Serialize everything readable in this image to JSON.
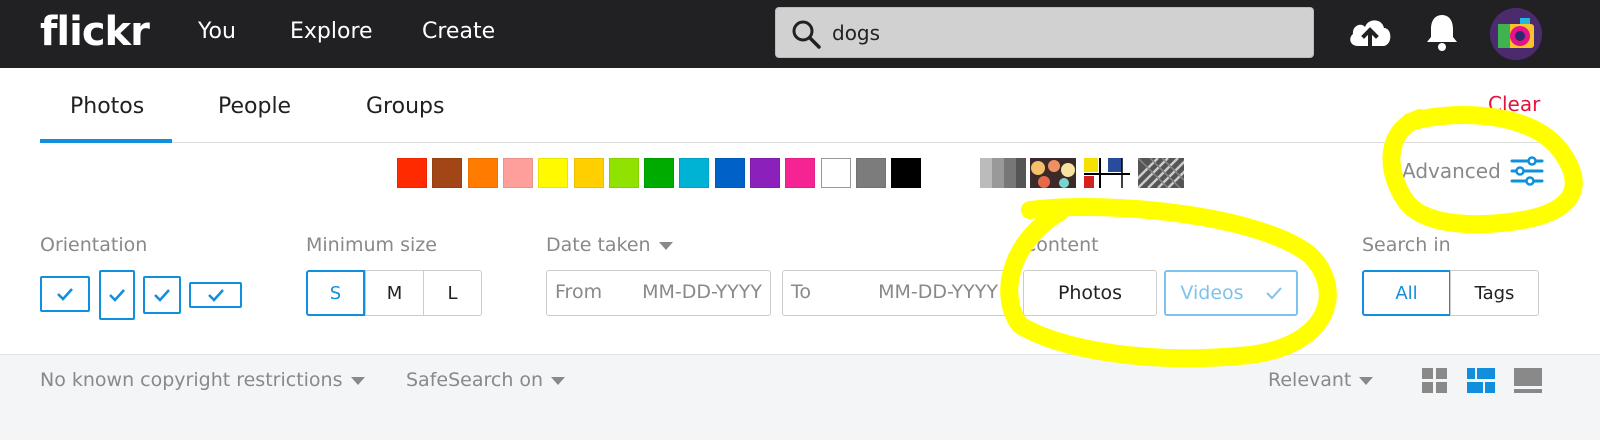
{
  "header": {
    "logo": "flickr",
    "nav": [
      "You",
      "Explore",
      "Create"
    ],
    "search": {
      "value": "dogs",
      "icon": "search-icon"
    },
    "icons": [
      "upload-cloud-icon",
      "bell-icon",
      "avatar"
    ]
  },
  "tabs": {
    "items": [
      "Photos",
      "People",
      "Groups"
    ],
    "active": "Photos",
    "clear_label": "Clear"
  },
  "colors": {
    "swatches": [
      "#ff2a00",
      "#a24615",
      "#ff7c00",
      "#ff9f9c",
      "#fffa00",
      "#ffcf00",
      "#90e200",
      "#00ab00",
      "#00b2d4",
      "#0062c6",
      "#8c20ba",
      "#f52394",
      "#ffffff",
      "#7c7c7c",
      "#000000"
    ],
    "style_swatches": [
      "black-and-white",
      "shallow-depth-of-field",
      "minimalist",
      "patterns"
    ],
    "accent": "#128fdc",
    "clear_color": "#e6123d",
    "annotation_color": "#ffff00"
  },
  "advanced": {
    "label": "Advanced",
    "icon": "sliders-icon"
  },
  "filters": {
    "orientation": {
      "label": "Orientation"
    },
    "min_size": {
      "label": "Minimum size",
      "options": [
        "S",
        "M",
        "L"
      ],
      "selected": "S"
    },
    "date_taken": {
      "label": "Date taken",
      "from_prefix": "From",
      "to_prefix": "To",
      "placeholder": "MM-DD-YYYY"
    },
    "content": {
      "label": "Content",
      "options": [
        "Photos",
        "Videos"
      ],
      "selected": "Videos"
    },
    "search_in": {
      "label": "Search in",
      "options": [
        "All",
        "Tags"
      ],
      "selected": "All"
    }
  },
  "bottom": {
    "license": "No known copyright restrictions",
    "safesearch": "SafeSearch on",
    "sort": "Relevant",
    "views": [
      "grid-small-icon",
      "justified-view-icon",
      "large-view-icon"
    ]
  }
}
